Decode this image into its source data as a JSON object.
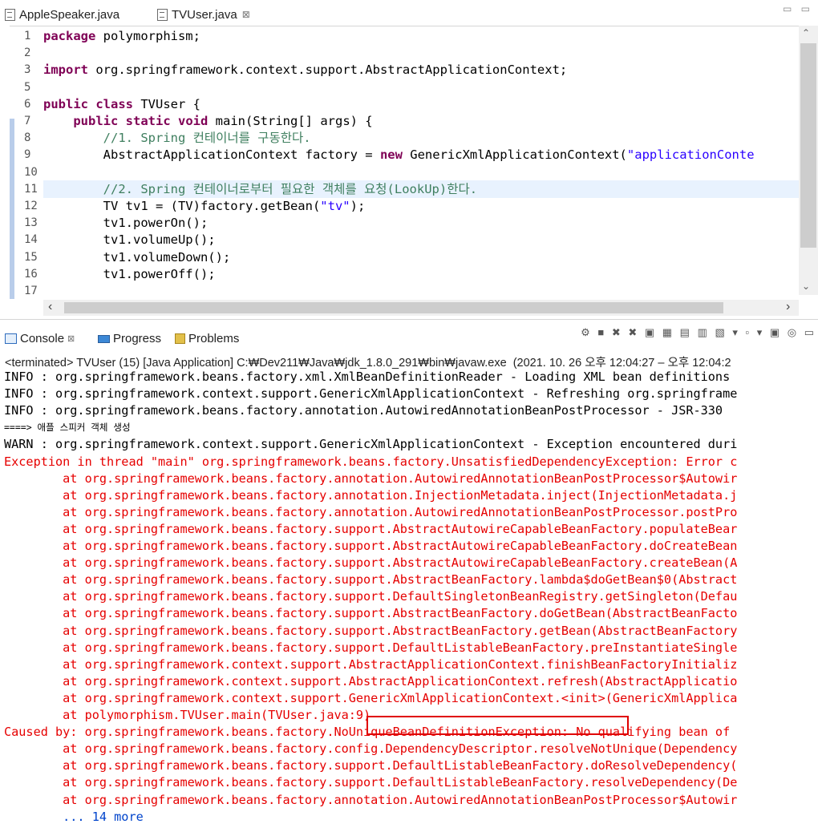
{
  "editor": {
    "tabs": [
      {
        "label": "AppleSpeaker.java"
      },
      {
        "label": "TVUser.java",
        "close": "⊠"
      }
    ],
    "lines": [
      {
        "num": "1",
        "parts": [
          [
            "kw",
            "package"
          ],
          [
            "",
            " polymorphism;"
          ]
        ]
      },
      {
        "num": "2",
        "parts": []
      },
      {
        "num": "3",
        "parts": [
          [
            "kw",
            "import"
          ],
          [
            "",
            " org.springframework.context.support.AbstractApplicationContext;"
          ]
        ]
      },
      {
        "num": "5",
        "parts": []
      },
      {
        "num": "6",
        "parts": [
          [
            "kw",
            "public"
          ],
          [
            "",
            " "
          ],
          [
            "kw",
            "class"
          ],
          [
            "",
            " TVUser {"
          ]
        ]
      },
      {
        "num": "7",
        "parts": [
          [
            "",
            "    "
          ],
          [
            "kw",
            "public"
          ],
          [
            "",
            " "
          ],
          [
            "kw",
            "static"
          ],
          [
            "",
            " "
          ],
          [
            "kw",
            "void"
          ],
          [
            "",
            " main(String[] args) {"
          ]
        ]
      },
      {
        "num": "8",
        "parts": [
          [
            "",
            "        "
          ],
          [
            "cm",
            "//1. Spring 컨테이너를 구동한다."
          ]
        ]
      },
      {
        "num": "9",
        "parts": [
          [
            "",
            "        AbstractApplicationContext factory = "
          ],
          [
            "kw",
            "new"
          ],
          [
            "",
            " GenericXmlApplicationContext("
          ],
          [
            "st",
            "\"applicationConte"
          ]
        ]
      },
      {
        "num": "10",
        "parts": []
      },
      {
        "num": "11",
        "parts": [
          [
            "",
            "        "
          ],
          [
            "cm",
            "//2. Spring 컨테이너로부터 필요한 객체를 요청(LookUp)한다."
          ]
        ]
      },
      {
        "num": "12",
        "parts": [
          [
            "",
            "        TV tv1 = (TV)factory.getBean("
          ],
          [
            "st",
            "\"tv\""
          ],
          [
            "",
            ");"
          ]
        ]
      },
      {
        "num": "13",
        "parts": [
          [
            "",
            "        tv1.powerOn();"
          ]
        ]
      },
      {
        "num": "14",
        "parts": [
          [
            "",
            "        tv1.volumeUp();"
          ]
        ]
      },
      {
        "num": "15",
        "parts": [
          [
            "",
            "        tv1.volumeDown();"
          ]
        ]
      },
      {
        "num": "16",
        "parts": [
          [
            "",
            "        tv1.powerOff();"
          ]
        ]
      },
      {
        "num": "17",
        "parts": []
      }
    ]
  },
  "console": {
    "tabs": [
      {
        "label": "Console",
        "close": "⊠"
      },
      {
        "label": "Progress"
      },
      {
        "label": "Problems"
      }
    ],
    "status": "<terminated> TVUser (15) [Java Application] C:₩Dev211₩Java₩jdk_1.8.0_291₩bin₩javaw.exe  (2021. 10. 26 오후 12:04:27 – 오후 12:04:2",
    "output": [
      {
        "type": "info",
        "text": "INFO : org.springframework.beans.factory.xml.XmlBeanDefinitionReader - Loading XML bean definitions"
      },
      {
        "type": "info",
        "text": "INFO : org.springframework.context.support.GenericXmlApplicationContext - Refreshing org.springframe"
      },
      {
        "type": "info",
        "text": "INFO : org.springframework.beans.factory.annotation.AutowiredAnnotationBeanPostProcessor - JSR-330"
      },
      {
        "type": "small",
        "text": "====> 애플 스피커 객체 생성"
      },
      {
        "type": "info",
        "text": "WARN : org.springframework.context.support.GenericXmlApplicationContext - Exception encountered duri"
      },
      {
        "type": "err",
        "text": "Exception in thread \"main\" org.springframework.beans.factory.UnsatisfiedDependencyException: Error c"
      },
      {
        "type": "err",
        "text": "        at org.springframework.beans.factory.annotation.AutowiredAnnotationBeanPostProcessor$Autowir"
      },
      {
        "type": "err",
        "text": "        at org.springframework.beans.factory.annotation.InjectionMetadata.inject(InjectionMetadata.j"
      },
      {
        "type": "err",
        "text": "        at org.springframework.beans.factory.annotation.AutowiredAnnotationBeanPostProcessor.postPro"
      },
      {
        "type": "err",
        "text": "        at org.springframework.beans.factory.support.AbstractAutowireCapableBeanFactory.populateBear"
      },
      {
        "type": "err",
        "text": "        at org.springframework.beans.factory.support.AbstractAutowireCapableBeanFactory.doCreateBean"
      },
      {
        "type": "err",
        "text": "        at org.springframework.beans.factory.support.AbstractAutowireCapableBeanFactory.createBean(A"
      },
      {
        "type": "err",
        "text": "        at org.springframework.beans.factory.support.AbstractBeanFactory.lambda$doGetBean$0(Abstract"
      },
      {
        "type": "err",
        "text": "        at org.springframework.beans.factory.support.DefaultSingletonBeanRegistry.getSingleton(Defau"
      },
      {
        "type": "err",
        "text": "        at org.springframework.beans.factory.support.AbstractBeanFactory.doGetBean(AbstractBeanFacto"
      },
      {
        "type": "err",
        "text": "        at org.springframework.beans.factory.support.AbstractBeanFactory.getBean(AbstractBeanFactory"
      },
      {
        "type": "err",
        "text": "        at org.springframework.beans.factory.support.DefaultListableBeanFactory.preInstantiateSingle"
      },
      {
        "type": "err",
        "text": "        at org.springframework.context.support.AbstractApplicationContext.finishBeanFactoryInitializ"
      },
      {
        "type": "err",
        "text": "        at org.springframework.context.support.AbstractApplicationContext.refresh(AbstractApplicatio"
      },
      {
        "type": "err",
        "text": "        at org.springframework.context.support.GenericXmlApplicationContext.<init>(GenericXmlApplica"
      },
      {
        "type": "err",
        "text": "        at polymorphism.TVUser.main(TVUser.java:9)"
      },
      {
        "type": "err",
        "text": "Caused by: org.springframework.beans.factory.NoUniqueBeanDefinitionException: No qualifying bean of"
      },
      {
        "type": "err",
        "text": "        at org.springframework.beans.factory.config.DependencyDescriptor.resolveNotUnique(Dependency"
      },
      {
        "type": "err",
        "text": "        at org.springframework.beans.factory.support.DefaultListableBeanFactory.doResolveDependency("
      },
      {
        "type": "err",
        "text": "        at org.springframework.beans.factory.support.DefaultListableBeanFactory.resolveDependency(De"
      },
      {
        "type": "err",
        "text": "        at org.springframework.beans.factory.annotation.AutowiredAnnotationBeanPostProcessor$Autowir"
      },
      {
        "type": "more",
        "text": "        ... 14 more"
      }
    ]
  }
}
